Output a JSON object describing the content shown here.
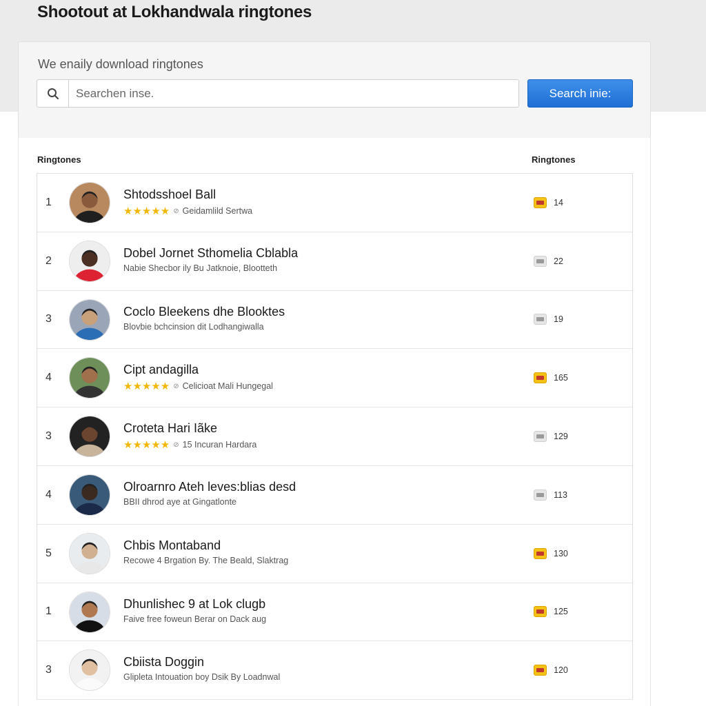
{
  "page": {
    "title": "Shootout at Lokhandwala ringtones"
  },
  "search": {
    "heading": "We enaily download ringtones",
    "placeholder": "Searchen inse.",
    "button_label": "Search inie:"
  },
  "list": {
    "left_header": "Ringtones",
    "right_header": "Ringtones",
    "rows": [
      {
        "rank": "1",
        "title": "Shtodsshoel Ball",
        "rated": true,
        "meta": "Geidamlild Sertwa",
        "count": "14",
        "badge": "gold"
      },
      {
        "rank": "2",
        "title": "Dobel Jornet Sthomelia Cblabla",
        "rated": false,
        "meta": "Nabie Shecbor ily Bu Jatknoie, Blootteth",
        "count": "22",
        "badge": "gray"
      },
      {
        "rank": "3",
        "title": "Coclo Bleekens dhe Blooktes",
        "rated": false,
        "meta": "Blovbie bchcinsion dit Lodhangiwalla",
        "count": "19",
        "badge": "gray"
      },
      {
        "rank": "4",
        "title": "Cipt andagilla",
        "rated": true,
        "meta": "Celicioat Mali Hungegal",
        "count": "165",
        "badge": "gold"
      },
      {
        "rank": "3",
        "title": "Croteta Hari Iãke",
        "rated": true,
        "meta": "15 Incuran Hardara",
        "count": "129",
        "badge": "gray"
      },
      {
        "rank": "4",
        "title": "Olroarnro Ateh leves:blias desd",
        "rated": false,
        "meta": "BBII dhrod aye at Gingatlonte",
        "count": "113",
        "badge": "gray"
      },
      {
        "rank": "5",
        "title": "Chbis Montaband",
        "rated": false,
        "meta": "Recowe 4 Brgation By. The Beald, Slaktrag",
        "count": "130",
        "badge": "gold"
      },
      {
        "rank": "1",
        "title": "Dhunlishec 9 at Lok clugb",
        "rated": false,
        "meta": "Faive free foweun Berar on Dack aug",
        "count": "125",
        "badge": "gold"
      },
      {
        "rank": "3",
        "title": "Cbiista Doggin",
        "rated": false,
        "meta": "Glipleta Intouation boy Dsik By Loadnwal",
        "count": "120",
        "badge": "gold"
      }
    ]
  },
  "icons": {
    "search": "search-icon",
    "badge": "ringtone-badge-icon",
    "star": "star-icon"
  },
  "colors": {
    "accent": "#2a7de1",
    "star": "#f2b705",
    "badge_gold": "#f5c316",
    "badge_gray": "#e6e6e6"
  }
}
